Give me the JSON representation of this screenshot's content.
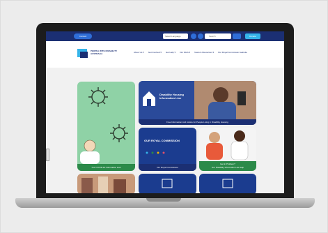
{
  "site": {
    "top_button_label": "Contact",
    "language_label": "Select Language",
    "search_placeholder": "Search",
    "donate_label": "Donate",
    "logo_text": "PEOPLE WITH DISABILITY AUSTRALIA"
  },
  "nav": {
    "items": [
      "About Us ▾",
      "Get Involved ▾",
      "Get Help ▾",
      "Our Work ▾",
      "News & Resources ▾",
      "Our Royal Commission website"
    ]
  },
  "tiles": {
    "covid_caption": "Our COVID-19 Information Hub",
    "housing_title": "Disability Housing Information Line",
    "housing_caption": "Free Information And Advice for People Living in Disability Housing",
    "royal_title": "OUR ROYAL COMMISSION",
    "royal_caption": "Our Royal Commission",
    "help_caption_1": "Get in Problem?",
    "help_caption_2": "Our Disability Information Hot Help"
  },
  "colors": {
    "navy": "#1b2f73",
    "green": "#2b8a49",
    "accent_blue": "#2f6ed8"
  }
}
